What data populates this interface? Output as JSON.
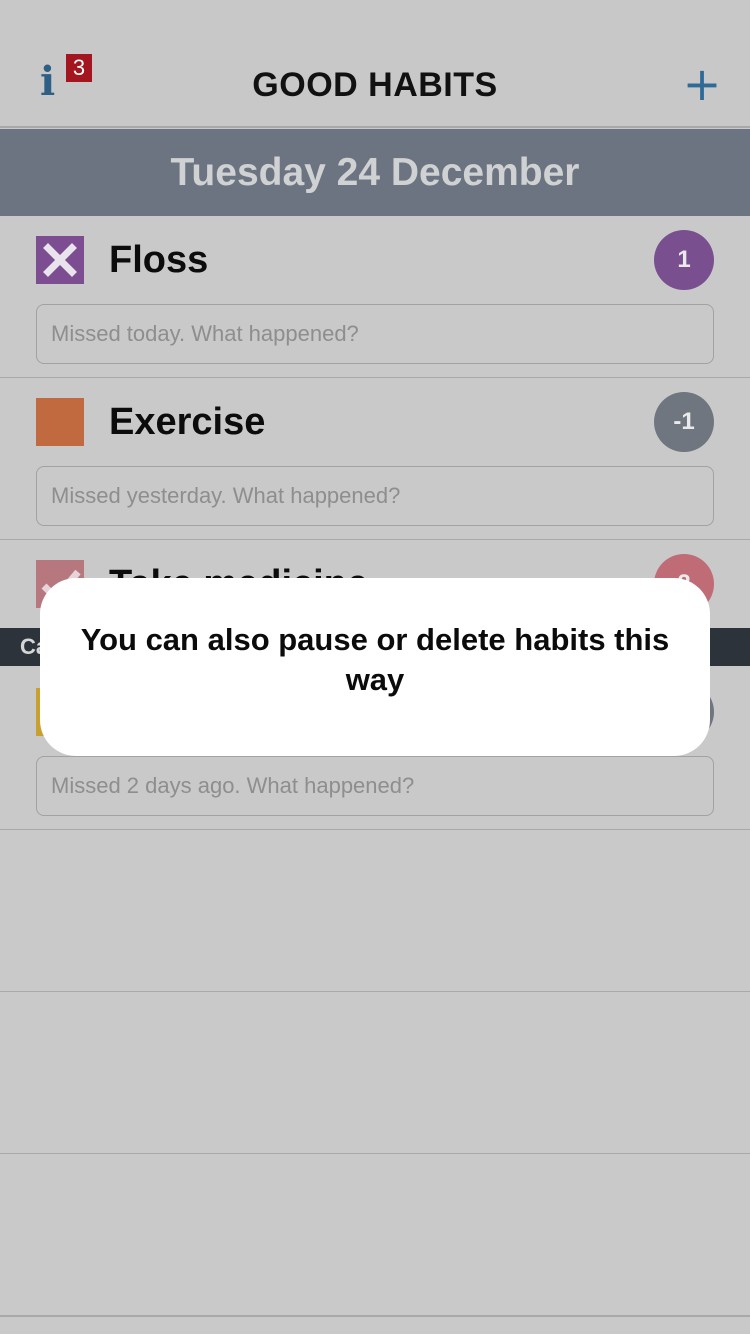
{
  "nav": {
    "info_icon": "info-icon",
    "info_badge": "3",
    "title": "GOOD HABITS",
    "add_icon": "plus-icon",
    "add_glyph": "+"
  },
  "date_header": "Tuesday 24 December",
  "habits": [
    {
      "name": "Floss",
      "status_icon": "x-mark-icon",
      "color": "#7c4e91",
      "count": "1",
      "count_color": "#7a4f90",
      "note_placeholder": "Missed today. What happened?"
    },
    {
      "name": "Exercise",
      "status_icon": "empty-square-icon",
      "color": "#c1693f",
      "count": "-1",
      "count_color": "#6f767f",
      "note_placeholder": "Missed yesterday. What happened?"
    },
    {
      "name": "Take medicine",
      "status_icon": "check-mark-icon",
      "color": "#b7777f",
      "count": "2",
      "count_color": "#bf6c76"
    },
    {
      "status_icon": "empty-square-icon",
      "color": "#c9a02f",
      "note_placeholder": "Missed 2 days ago. What happened?"
    }
  ],
  "category_label": "Ca",
  "tooltip": {
    "text": "You can also pause or delete habits this way"
  }
}
